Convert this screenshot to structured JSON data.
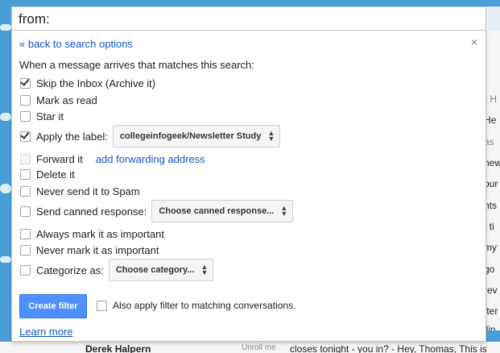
{
  "search": {
    "query": "from:"
  },
  "panel": {
    "back_link": "« back to search options",
    "close_glyph": "×",
    "intro": "When a message arrives that matches this search:",
    "options": {
      "skip_inbox": {
        "label": "Skip the Inbox (Archive it)",
        "checked": true
      },
      "mark_read": {
        "label": "Mark as read",
        "checked": false
      },
      "star": {
        "label": "Star it",
        "checked": false
      },
      "apply_label": {
        "label": "Apply the label:",
        "checked": true,
        "select": "collegeinfogeek/Newsletter Study"
      },
      "forward": {
        "label": "Forward it",
        "checked": false,
        "disabled": true,
        "link": "add forwarding address"
      },
      "delete": {
        "label": "Delete it",
        "checked": false
      },
      "never_spam": {
        "label": "Never send it to Spam",
        "checked": false
      },
      "canned": {
        "label": "Send canned response:",
        "checked": false,
        "select": "Choose canned response..."
      },
      "always_important": {
        "label": "Always mark it as important",
        "checked": false
      },
      "never_important": {
        "label": "Never mark it as important",
        "checked": false
      },
      "categorize": {
        "label": "Categorize as:",
        "checked": false,
        "select": "Choose category..."
      }
    },
    "create_button": "Create filter",
    "also_apply": "Also apply filter to matching conversations.",
    "learn_more": "Learn more"
  },
  "background": {
    "right_fragments": [
      "- H",
      "He",
      "as",
      "new",
      "our",
      "nts",
      "f ti",
      "my",
      "go",
      "rev",
      "fter",
      "ilin"
    ],
    "bottom_fragments": [
      "Derek Halpern",
      "Unroll me",
      "closes tonight - you in? - Hey, Thomas, This is"
    ]
  },
  "colors": {
    "accent": "#4d90fe",
    "link": "#1155cc",
    "background": "#4a9ed8"
  }
}
